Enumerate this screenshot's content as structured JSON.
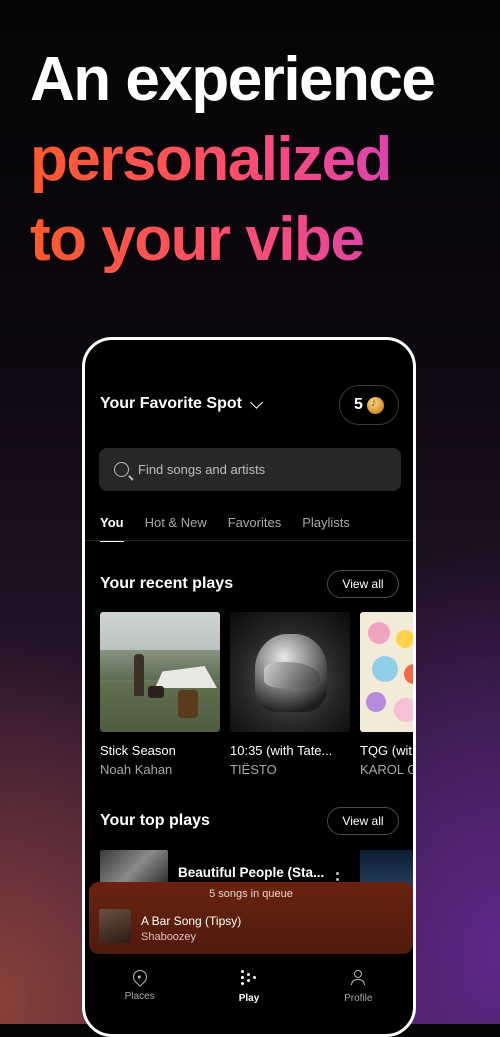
{
  "headline": {
    "line1": "An experience",
    "line2": "personalized",
    "line3": "to your vibe"
  },
  "header": {
    "venue": "Your Favorite Spot",
    "coin_count": "5"
  },
  "search": {
    "placeholder": "Find songs and artists"
  },
  "tabs": [
    {
      "label": "You"
    },
    {
      "label": "Hot & New"
    },
    {
      "label": "Favorites"
    },
    {
      "label": "Playlists"
    }
  ],
  "recent": {
    "title": "Your recent plays",
    "view_all": "View all",
    "items": [
      {
        "title": "Stick Season",
        "artist": "Noah Kahan"
      },
      {
        "title": "10:35 (with Tate...",
        "artist": "TIËSTO"
      },
      {
        "title": "TQG (wit",
        "artist": "KAROL G"
      }
    ]
  },
  "top": {
    "title": "Your top plays",
    "view_all": "View all",
    "items": [
      {
        "title": "Beautiful People (Sta..."
      }
    ]
  },
  "player": {
    "queue": "5 songs in queue",
    "title": "A Bar Song (Tipsy)",
    "artist": "Shaboozey"
  },
  "nav": [
    {
      "label": "Places"
    },
    {
      "label": "Play"
    },
    {
      "label": "Profile"
    }
  ],
  "colors": {
    "gradient_start": "#ff5a2c",
    "gradient_end": "#c43fd8",
    "player_bg": "#6b2310"
  }
}
